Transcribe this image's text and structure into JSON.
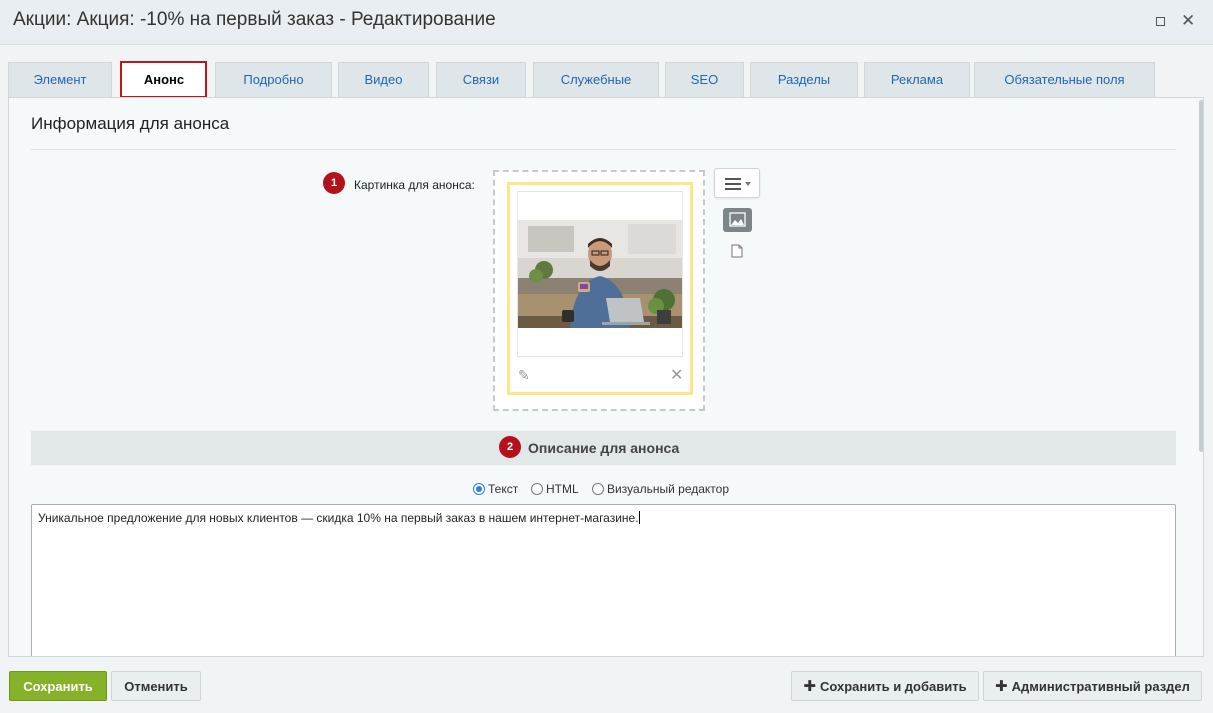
{
  "window": {
    "title": "Акции: Акция: -10% на первый заказ - Редактирование",
    "maximize_icon": "maximize-icon",
    "close_icon": "close-icon"
  },
  "tabs": [
    {
      "label": "Элемент",
      "active": false
    },
    {
      "label": "Анонс",
      "active": true
    },
    {
      "label": "Подробно",
      "active": false
    },
    {
      "label": "Видео",
      "active": false
    },
    {
      "label": "Связи",
      "active": false
    },
    {
      "label": "Служебные",
      "active": false
    },
    {
      "label": "SEO",
      "active": false
    },
    {
      "label": "Разделы",
      "active": false
    },
    {
      "label": "Реклама",
      "active": false
    },
    {
      "label": "Обязательные поля",
      "active": false
    }
  ],
  "section": {
    "title": "Информация для анонса"
  },
  "preview_image": {
    "badge": "1",
    "label": "Картинка для анонса:",
    "edit_icon": "pencil-icon",
    "delete_icon": "close-icon"
  },
  "description": {
    "badge": "2",
    "title": "Описание для анонса",
    "modes": [
      {
        "label": "Текст",
        "checked": true
      },
      {
        "label": "HTML",
        "checked": false
      },
      {
        "label": "Визуальный редактор",
        "checked": false
      }
    ],
    "text": "Уникальное предложение для новых клиентов — скидка 10% на первый заказ в нашем интернет-магазине."
  },
  "footer": {
    "save": "Сохранить",
    "cancel": "Отменить",
    "save_and_add": "Сохранить и добавить",
    "admin_section": "Административный раздел"
  },
  "colors": {
    "accent_red": "#b3121a",
    "save_green": "#86b22a",
    "link_blue": "#2067b0"
  }
}
